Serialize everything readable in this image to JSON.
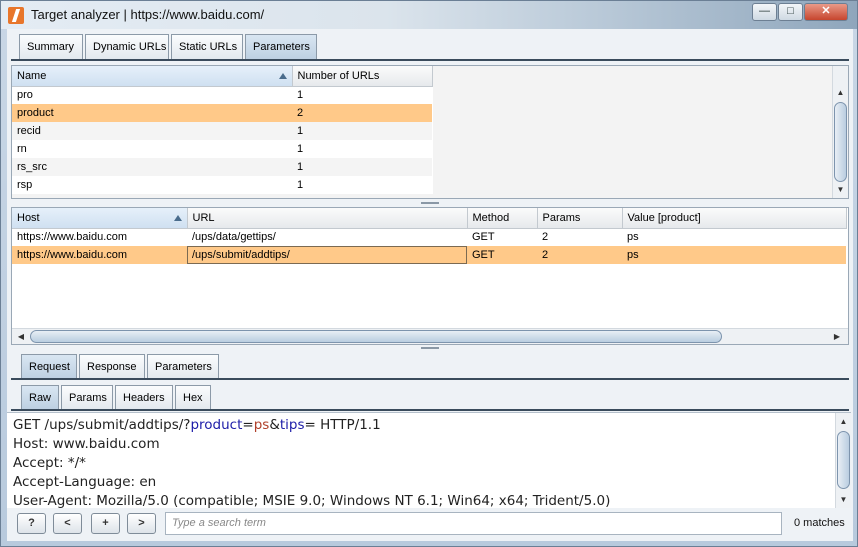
{
  "window": {
    "title": "Target analyzer | https://www.baidu.com/",
    "controls": [
      "minimize",
      "maximize",
      "close"
    ]
  },
  "top_tabs": [
    {
      "label": "Summary",
      "active": false
    },
    {
      "label": "Dynamic URLs",
      "active": false
    },
    {
      "label": "Static URLs",
      "active": false
    },
    {
      "label": "Parameters",
      "active": true
    }
  ],
  "params_table": {
    "columns": [
      "Name",
      "Number of URLs"
    ],
    "sorted_column": "Name",
    "rows": [
      {
        "name": "pro",
        "count": "1",
        "selected": false
      },
      {
        "name": "product",
        "count": "2",
        "selected": true
      },
      {
        "name": "recid",
        "count": "1",
        "selected": false
      },
      {
        "name": "rn",
        "count": "1",
        "selected": false
      },
      {
        "name": "rs_src",
        "count": "1",
        "selected": false
      },
      {
        "name": "rsp",
        "count": "1",
        "selected": false
      }
    ]
  },
  "urls_table": {
    "columns": [
      "Host",
      "URL",
      "Method",
      "Params",
      "Value [product]"
    ],
    "sorted_column": "Host",
    "rows": [
      {
        "host": "https://www.baidu.com",
        "url": "/ups/data/gettips/",
        "method": "GET",
        "params": "2",
        "value": "ps",
        "selected": false
      },
      {
        "host": "https://www.baidu.com",
        "url": "/ups/submit/addtips/",
        "method": "GET",
        "params": "2",
        "value": "ps",
        "selected": true
      }
    ]
  },
  "message_tabs": [
    {
      "label": "Request",
      "active": true
    },
    {
      "label": "Response",
      "active": false
    },
    {
      "label": "Parameters",
      "active": false
    }
  ],
  "view_tabs": [
    {
      "label": "Raw",
      "active": true
    },
    {
      "label": "Params",
      "active": false
    },
    {
      "label": "Headers",
      "active": false
    },
    {
      "label": "Hex",
      "active": false
    }
  ],
  "request": {
    "line1": {
      "prefix": "GET /ups/submit/addtips/?",
      "p1": "product",
      "eq1": "=",
      "v1": "ps",
      "amp": "&",
      "p2": "tips",
      "suffix": "= HTTP/1.1"
    },
    "line2": "Host: www.baidu.com",
    "line3": "Accept: */*",
    "line4": "Accept-Language: en",
    "line5": "User-Agent: Mozilla/5.0 (compatible; MSIE 9.0; Windows NT 6.1; Win64; x64; Trident/5.0)"
  },
  "bottom_bar": {
    "help": "?",
    "prev": "<",
    "add": "+",
    "next": ">",
    "search_placeholder": "Type a search term",
    "matches": "0 matches"
  }
}
